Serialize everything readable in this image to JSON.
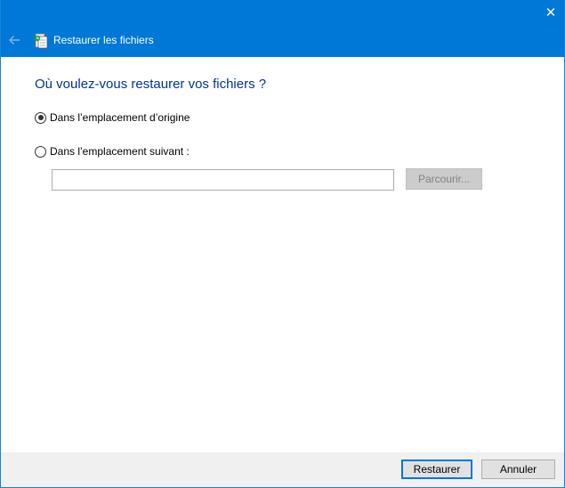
{
  "window": {
    "title": "Restaurer les fichiers",
    "close_glyph": "✕",
    "accent_color": "#0078d7"
  },
  "icons": {
    "back": "back-arrow-icon",
    "app": "file-history-icon",
    "close": "close-icon"
  },
  "content": {
    "question": "Où voulez-vous restaurer vos fichiers ?",
    "options": [
      {
        "label": "Dans l’emplacement d’origine",
        "selected": true
      },
      {
        "label": "Dans l’emplacement suivant :",
        "selected": false
      }
    ],
    "path_input": {
      "value": "",
      "placeholder": ""
    },
    "browse_label": "Parcourir..."
  },
  "footer": {
    "restore_label": "Restaurer",
    "cancel_label": "Annuler"
  }
}
